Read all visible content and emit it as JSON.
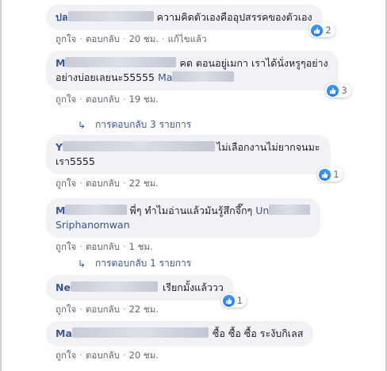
{
  "actions": {
    "like": "ถูกใจ",
    "reply": "ตอบกลับ",
    "separator": "·"
  },
  "comments": [
    {
      "name": "ปล",
      "text": "ความคิดตัวเองคืออุปสรรคของตัวเอง",
      "time": "20 ชม.",
      "edited": "แก้ไขแล้ว",
      "reactions": "2"
    },
    {
      "name": "M",
      "text_line1": "คด ตอนอยู่เมกา เราได้นั่งหรูๆอย่าง",
      "text_line2": "อย่างบ่อยเลยนะ55555",
      "tag_start": "Ma",
      "time": "19 ชม.",
      "reactions": "3"
    },
    {
      "name": "Y",
      "text_line1": "ไม่เลือกงานไม่ยากจนมะ",
      "text_line2": "เรา5555",
      "time": "22 ชม.",
      "reactions": "1"
    },
    {
      "name": "M",
      "text": "พี่ๆ ทำไมอ่านแล้วมันรู้สึกจึ๊กๆ",
      "tag_start": "Un",
      "tag_end": "Sriphanomwan",
      "time": "1 ชม."
    },
    {
      "name": "Ne",
      "text": "เรียกมั้งแล้ววว",
      "time": "22 ชม.",
      "reactions": "1"
    },
    {
      "name": "Ma",
      "text": "ซื้อ ซื้อ ซื้อ ระงับกิเลส",
      "time": "20 ชม."
    }
  ],
  "reply_links": [
    {
      "label": "การตอบกลับ 3 รายการ"
    },
    {
      "label": "การตอบกลับ 1 รายการ"
    }
  ],
  "colors": {
    "bubble": "#f0f2f5",
    "name": "#385898",
    "like": "#1877f2",
    "meta": "#606770"
  }
}
